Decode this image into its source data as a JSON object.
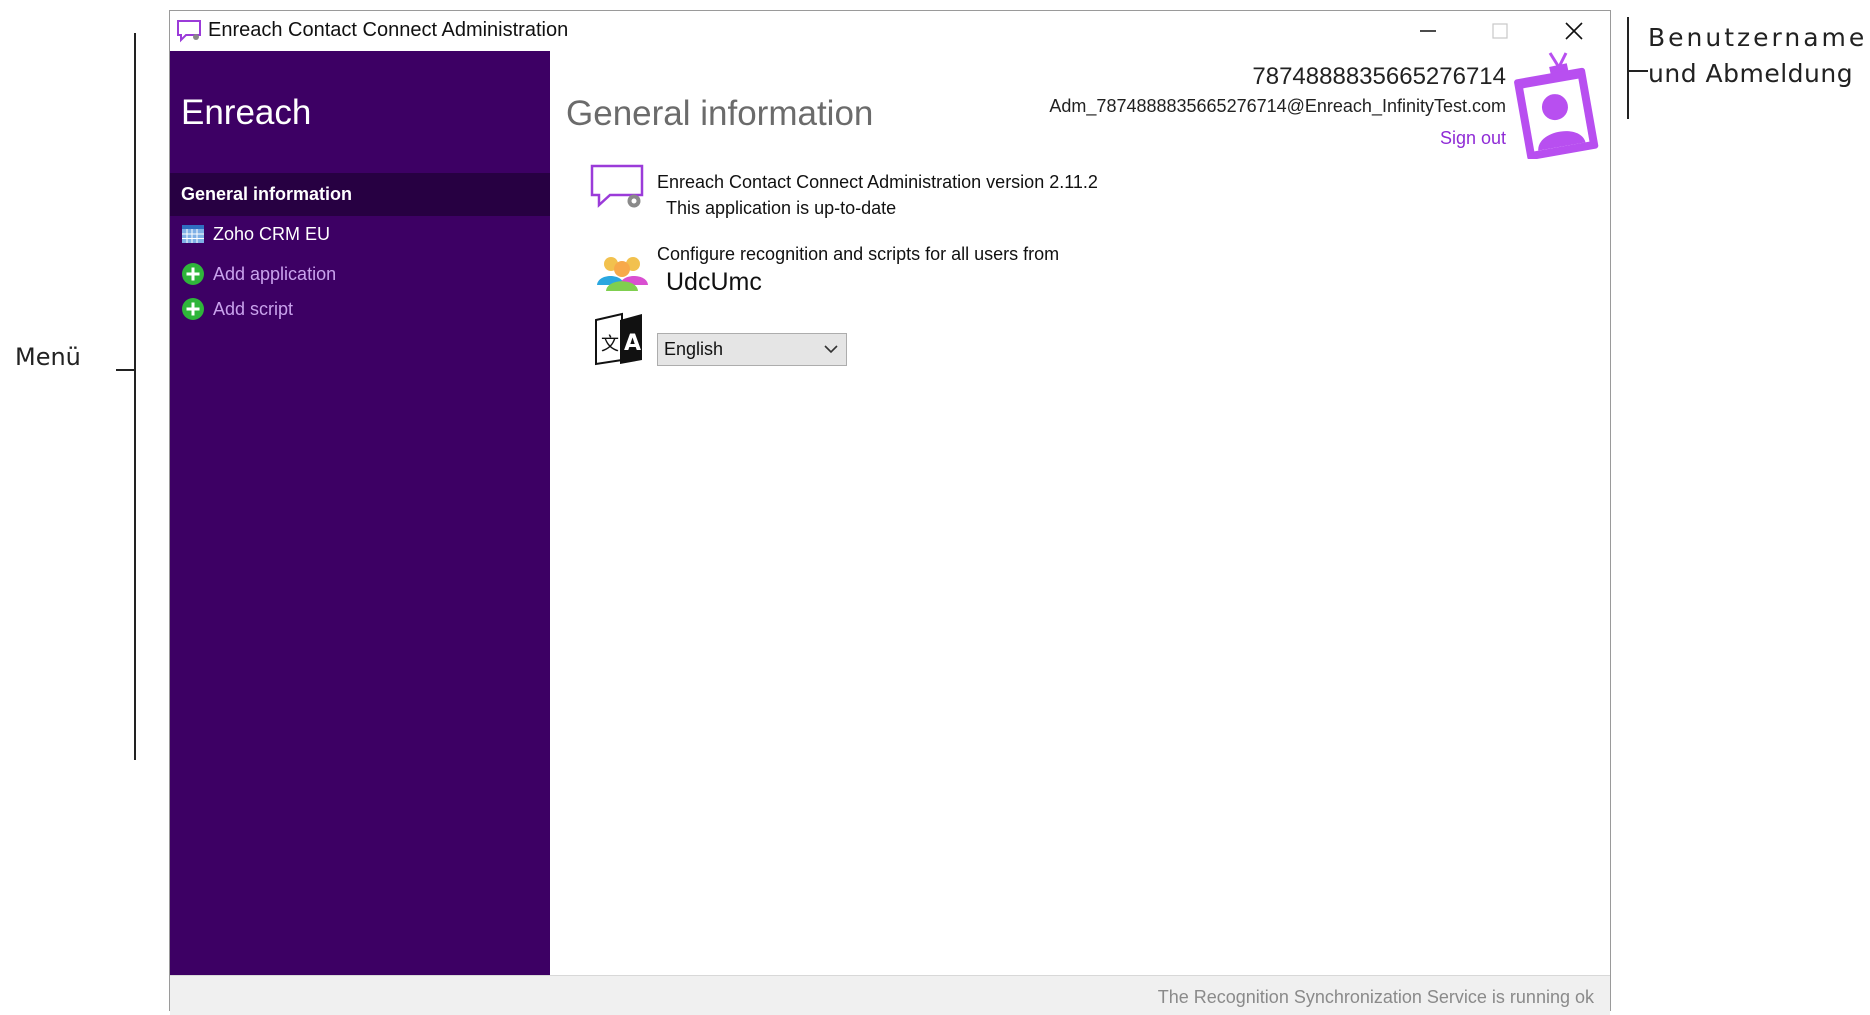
{
  "annotations": {
    "menu_label": "Menü",
    "user_label_line1": "Benutzername",
    "user_label_line2": "und Abmeldung"
  },
  "window": {
    "title": "Enreach Contact Connect Administration",
    "icons": [
      "chat-icon",
      "minimize-icon",
      "maximize-icon",
      "close-icon"
    ]
  },
  "sidebar": {
    "brand": "Enreach",
    "active_item": "General information",
    "items": [
      {
        "label": "Zoho CRM EU",
        "icon": "table-icon"
      },
      {
        "label": "Add application",
        "icon": "plus-circle-icon"
      },
      {
        "label": "Add script",
        "icon": "plus-circle-icon"
      }
    ]
  },
  "main": {
    "title": "General information",
    "user": {
      "id": "7874888835665276714",
      "email": "Adm_7874888835665276714@Enreach_InfinityTest.com",
      "sign_out": "Sign out"
    },
    "version_line": "Enreach Contact Connect Administration version 2.11.2",
    "status_line": "This application is up-to-date",
    "configure_line": "Configure recognition and scripts for all users from",
    "source": "UdcUmc",
    "language": "English"
  },
  "statusbar": {
    "text": "The Recognition Synchronization Service is running ok"
  },
  "colors": {
    "sidebar_bg": "#3d0064",
    "sidebar_active_bg": "#270042",
    "accent": "#8f2bd6",
    "link": "#c9a2ec"
  }
}
